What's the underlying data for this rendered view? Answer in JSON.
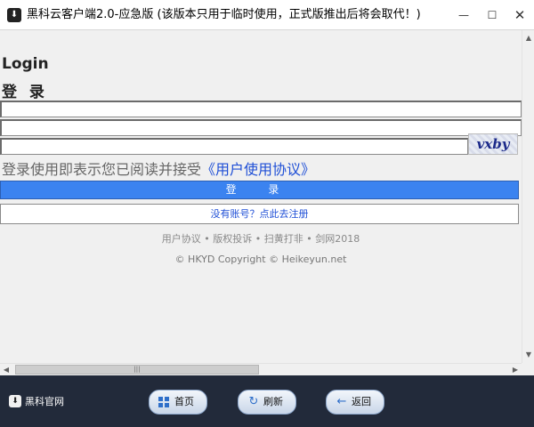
{
  "window": {
    "title": "黑科云客户端2.0-应急版 (该版本只用于临时使用，正式版推出后将会取代！)",
    "controls": {
      "minimize": "—",
      "maximize": "☐",
      "close": "✕"
    }
  },
  "login": {
    "heading_en": "Login",
    "heading_cn": "登 录",
    "captcha_text": "vxby",
    "agreement_text": "登录使用即表示您已阅读并接受",
    "agreement_link": "《用户使用协议》",
    "login_button": "登 录",
    "register_link": "没有账号？点此去注册"
  },
  "footer": {
    "links": "用户协议 • 版权投诉 • 扫黄打非 • 剑网2018",
    "copyright": "© HKYD Copyright © Heikeyun.net"
  },
  "bottombar": {
    "brand": "黑科官网",
    "home": "首页",
    "refresh": "刷新",
    "back": "返回"
  },
  "colors": {
    "accent": "#3b83f0",
    "link": "#1f4fd6",
    "bottombar": "#222a3a"
  }
}
